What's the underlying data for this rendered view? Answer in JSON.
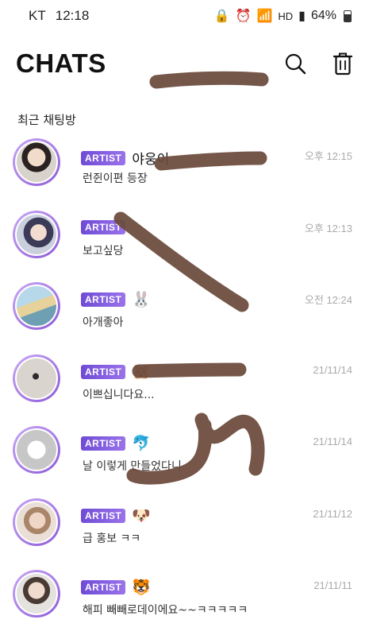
{
  "status_bar": {
    "carrier": "KT",
    "time": "12:18",
    "battery": "64%",
    "indicator_hd": "HD"
  },
  "header": {
    "title": "CHATS",
    "search_icon": "search-icon",
    "trash_icon": "trash-icon"
  },
  "section": {
    "label": "최근 채팅방"
  },
  "colors": {
    "accent": "#7b55dc",
    "scribble": "#6b4a3c"
  },
  "chats": [
    {
      "badge": "ARTIST",
      "name": "야웅이",
      "emoji": "",
      "preview": "런쥔이편 등장",
      "time": "오후 12:15"
    },
    {
      "badge": "ARTIST",
      "name": "",
      "emoji": "",
      "preview": "보고싶당",
      "time": "오후 12:13"
    },
    {
      "badge": "ARTIST",
      "name": "",
      "emoji": "🐰",
      "preview": "아개좋아",
      "time": "오전 12:24"
    },
    {
      "badge": "ARTIST",
      "name": "",
      "emoji": "🐹",
      "preview": "이쁘십니다요...",
      "time": "21/11/14"
    },
    {
      "badge": "ARTIST",
      "name": "",
      "emoji": "🐬",
      "preview": "날 이렇게 만들었다니",
      "time": "21/11/14"
    },
    {
      "badge": "ARTIST",
      "name": "",
      "emoji": "🐶",
      "preview": "급 홍보 ㅋㅋ",
      "time": "21/11/12"
    },
    {
      "badge": "ARTIST",
      "name": "",
      "emoji": "🐯",
      "preview": "해피 빼빼로데이에요~~ㅋㅋㅋㅋㅋ",
      "time": "21/11/11"
    }
  ]
}
